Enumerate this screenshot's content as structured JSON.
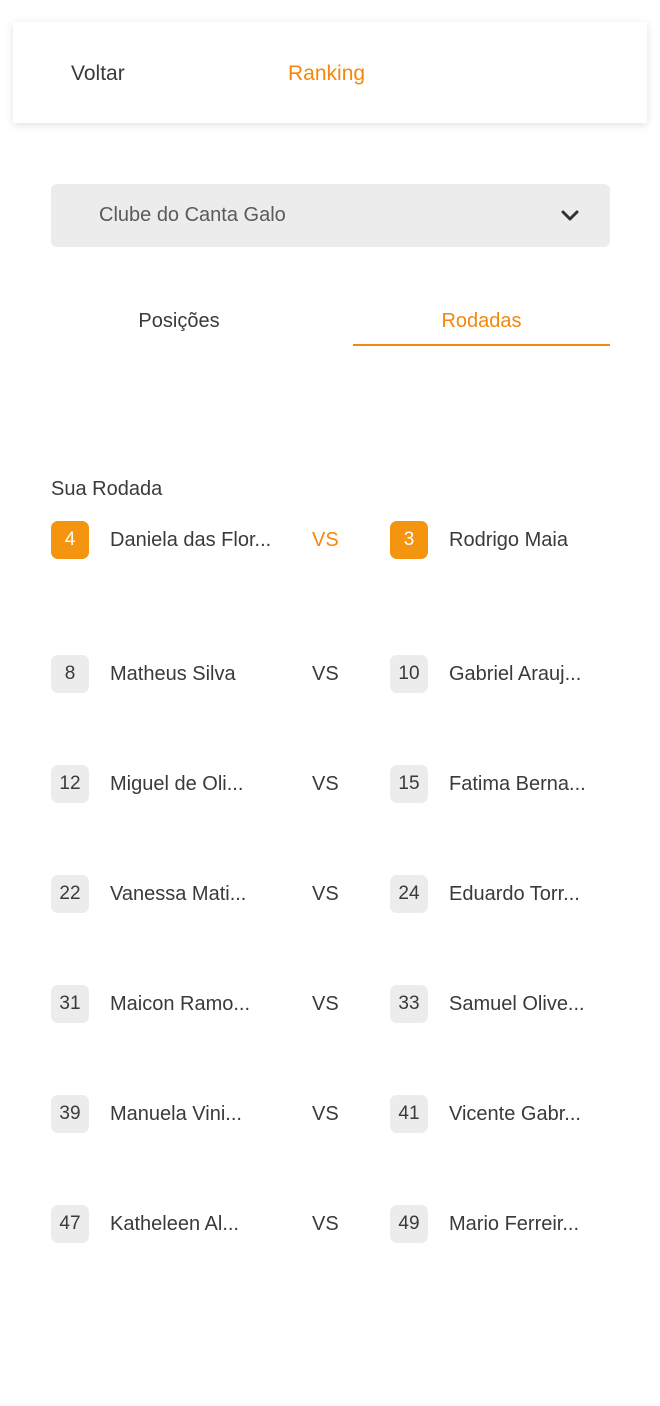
{
  "header": {
    "back_label": "Voltar",
    "title": "Ranking"
  },
  "club_select": {
    "value": "Clube do Canta Galo",
    "icon": "chevron-down-icon"
  },
  "tabs": [
    {
      "label": "Posições",
      "active": false
    },
    {
      "label": "Rodadas",
      "active": true
    }
  ],
  "your_round": {
    "label": "Sua Rodada",
    "match": {
      "left_pos": "4",
      "left_name": "Daniela das Flor...",
      "vs": "VS",
      "right_pos": "3",
      "right_name": "Rodrigo Maia"
    }
  },
  "matches": [
    {
      "left_pos": "8",
      "left_name": "Matheus Silva",
      "vs": "VS",
      "right_pos": "10",
      "right_name": "Gabriel Arauj..."
    },
    {
      "left_pos": "12",
      "left_name": "Miguel de Oli...",
      "vs": "VS",
      "right_pos": "15",
      "right_name": "Fatima Berna..."
    },
    {
      "left_pos": "22",
      "left_name": "Vanessa Mati...",
      "vs": "VS",
      "right_pos": "24",
      "right_name": "Eduardo Torr..."
    },
    {
      "left_pos": "31",
      "left_name": "Maicon Ramo...",
      "vs": "VS",
      "right_pos": "33",
      "right_name": "Samuel Olive..."
    },
    {
      "left_pos": "39",
      "left_name": "Manuela Vini...",
      "vs": "VS",
      "right_pos": "41",
      "right_name": "Vicente Gabr..."
    },
    {
      "left_pos": "47",
      "left_name": "Katheleen Al...",
      "vs": "VS",
      "right_pos": "49",
      "right_name": "Mario Ferreir..."
    }
  ],
  "colors": {
    "accent": "#f5870a",
    "badge_bg": "#ececec",
    "text": "#3a3a3a"
  }
}
